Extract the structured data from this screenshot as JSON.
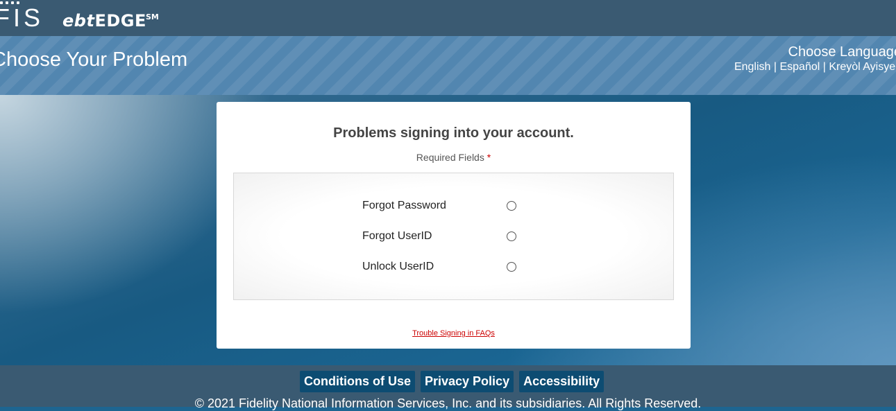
{
  "header": {
    "logo_fis": "FIS",
    "logo_ebt": "ebt",
    "logo_edge": "EDGE",
    "logo_sm": "SM"
  },
  "title_band": {
    "page_title": "Choose Your Problem",
    "language_heading": "Choose Language",
    "languages": [
      "English",
      "Español",
      "Kreyòl Ayisyen"
    ],
    "separator": " | "
  },
  "card": {
    "title": "Problems signing into your account.",
    "required_label": "Required Fields",
    "required_marker": "*",
    "options": [
      {
        "label": "Forgot Password",
        "selected": false
      },
      {
        "label": "Forgot UserID",
        "selected": false
      },
      {
        "label": "Unlock UserID",
        "selected": false
      }
    ],
    "faq_link": "Trouble Signing in FAQs"
  },
  "footer": {
    "links": [
      "Conditions of Use",
      "Privacy Policy",
      "Accessibility"
    ],
    "copyright": "© 2021 Fidelity National Information Services, Inc. and its subsidiaries. All Rights Reserved."
  },
  "colors": {
    "header_bg": "#3a5a72",
    "title_band_bg": "#5286b0",
    "footer_button_bg": "#0d4c72",
    "link_red": "#cc0000"
  }
}
